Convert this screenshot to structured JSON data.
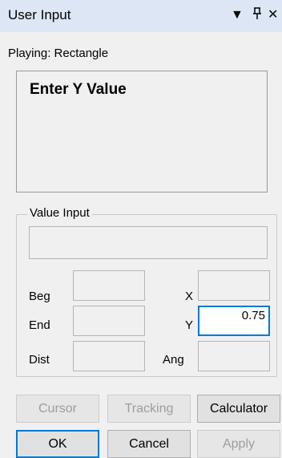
{
  "window": {
    "title": "User Input",
    "icons": [
      "chevron-down-icon",
      "pin-icon",
      "close-icon"
    ]
  },
  "status": {
    "playing": "Playing: Rectangle"
  },
  "prompt": {
    "text": "Enter Y Value"
  },
  "value_input": {
    "group_label": "Value Input",
    "value": "",
    "rows": {
      "beg_label": "Beg",
      "x_label": "X",
      "end_label": "End",
      "y_label": "Y",
      "y_value": "0.75",
      "dist_label": "Dist",
      "ang_label": "Ang"
    }
  },
  "buttons": {
    "cursor": "Cursor",
    "tracking": "Tracking",
    "calculator": "Calculator",
    "ok": "OK",
    "cancel": "Cancel",
    "apply": "Apply"
  }
}
